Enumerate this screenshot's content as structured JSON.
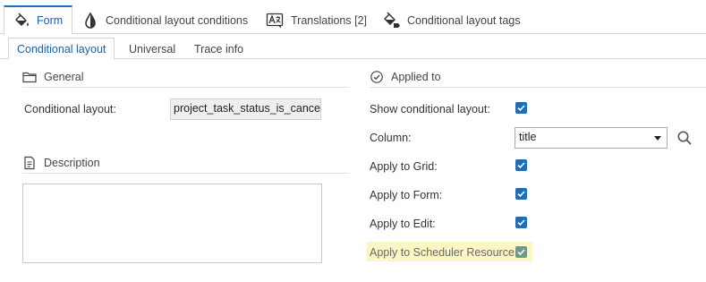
{
  "tabs": {
    "form": "Form",
    "conditional_layout_conditions": "Conditional layout conditions",
    "translations": "Translations [2]",
    "conditional_layout_tags": "Conditional layout tags"
  },
  "subtabs": {
    "conditional_layout": "Conditional layout",
    "universal": "Universal",
    "trace_info": "Trace info"
  },
  "general": {
    "header": "General",
    "conditional_layout_label": "Conditional layout:",
    "conditional_layout_value": "project_task_status_is_canceled"
  },
  "description": {
    "header": "Description"
  },
  "applied_to": {
    "header": "Applied to",
    "show_conditional_layout": "Show conditional layout:",
    "column_label": "Column:",
    "column_value": "title",
    "apply_to_grid": "Apply to Grid:",
    "apply_to_form": "Apply to Form:",
    "apply_to_edit": "Apply to Edit:",
    "apply_to_scheduler_resource": "Apply to Scheduler Resource:"
  },
  "colors": {
    "accent": "#1e6fb8",
    "checkbox": "#1f6fb5",
    "checkbox_disabled": "#6f9a86",
    "highlight": "#fcf6c5"
  },
  "icons": {
    "form": "paint-bucket-icon",
    "conditional_layout_conditions": "drop-icon",
    "translations": "translate-icon",
    "conditional_layout_tags": "paint-bucket-tag-icon",
    "general": "folder-icon",
    "description": "document-icon",
    "applied_to": "check-circle-icon",
    "column_search": "search-icon"
  }
}
